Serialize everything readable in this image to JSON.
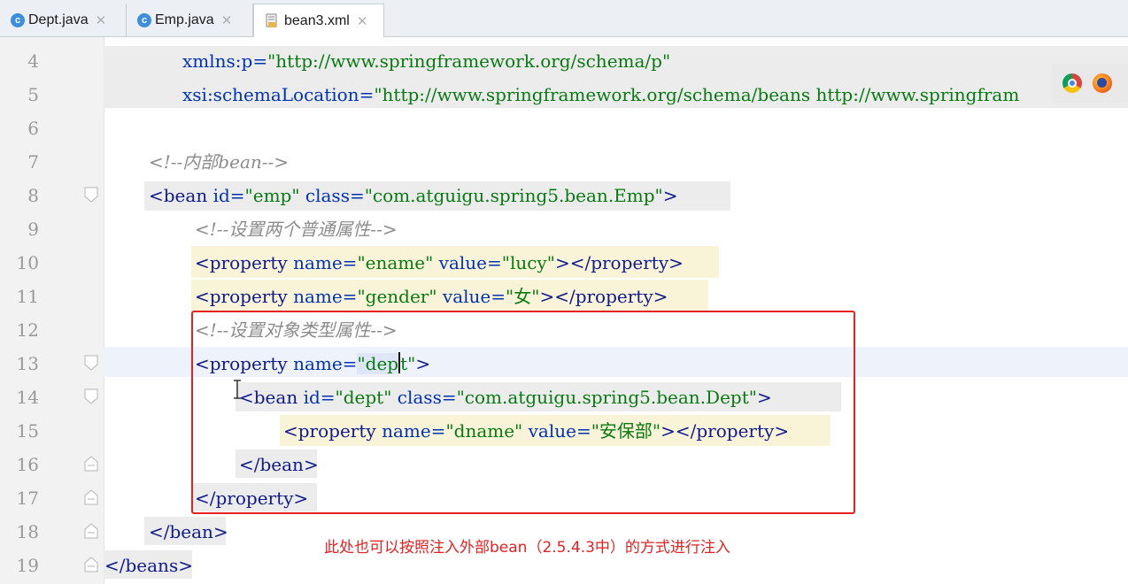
{
  "tabs": [
    {
      "label": "Dept.java",
      "kind": "java"
    },
    {
      "label": "Emp.java",
      "kind": "java"
    },
    {
      "label": "bean3.xml",
      "kind": "xml",
      "active": true
    }
  ],
  "lines": {
    "4": {
      "num": "4",
      "attr": "xmlns:p",
      "value": "\"http://www.springframework.org/schema/p\""
    },
    "5": {
      "num": "5",
      "attr": "xsi:schemaLocation",
      "value": "\"http://www.springframework.org/schema/beans http://www.springfram"
    },
    "6": {
      "num": "6"
    },
    "7": {
      "num": "7",
      "comment": "<!--内部bean-->"
    },
    "8": {
      "num": "8",
      "tag": "<bean",
      "a1": "id",
      "v1": "\"emp\"",
      "a2": "class",
      "v2": "\"com.atguigu.spring5.bean.Emp\"",
      "end": ">"
    },
    "9": {
      "num": "9",
      "comment": "<!--设置两个普通属性-->"
    },
    "10": {
      "num": "10",
      "tag": "<property",
      "a1": "name",
      "v1": "\"ename\"",
      "a2": "value",
      "v2": "\"lucy\"",
      "end": "></property>"
    },
    "11": {
      "num": "11",
      "tag": "<property",
      "a1": "name",
      "v1": "\"gender\"",
      "a2": "value",
      "v2": "\"女\"",
      "end": "></property>"
    },
    "12": {
      "num": "12",
      "comment": "<!--设置对象类型属性-->"
    },
    "13": {
      "num": "13",
      "tag": "<property",
      "a1": "name",
      "v1a": "\"dep",
      "v1b": "t\"",
      "end": ">"
    },
    "14": {
      "num": "14",
      "tag": "<bean",
      "a1": "id",
      "v1": "\"dept\"",
      "a2": "class",
      "v2": "\"com.atguigu.spring5.bean.Dept\"",
      "end": ">"
    },
    "15": {
      "num": "15",
      "tag": "<property",
      "a1": "name",
      "v1": "\"dname\"",
      "a2": "value",
      "v2": "\"安保部\"",
      "end": "></property>"
    },
    "16": {
      "num": "16",
      "tag": "</bean>"
    },
    "17": {
      "num": "17",
      "tag": "</property>"
    },
    "18": {
      "num": "18",
      "tag": "</bean>"
    },
    "19": {
      "num": "19",
      "tag": "</beans>"
    }
  },
  "annotation": "此处也可以按照注入外部bean（2.5.4.3中）的方式进行注入",
  "colors": {
    "tag": "#0f1a8e",
    "attr": "#0033b3",
    "value": "#077a11",
    "comment": "#8c8c8c",
    "annotation": "#e42222"
  },
  "icons": [
    "java-class-icon",
    "xml-file-icon",
    "close-icon",
    "fold-icon",
    "chrome-icon",
    "firefox-icon"
  ]
}
